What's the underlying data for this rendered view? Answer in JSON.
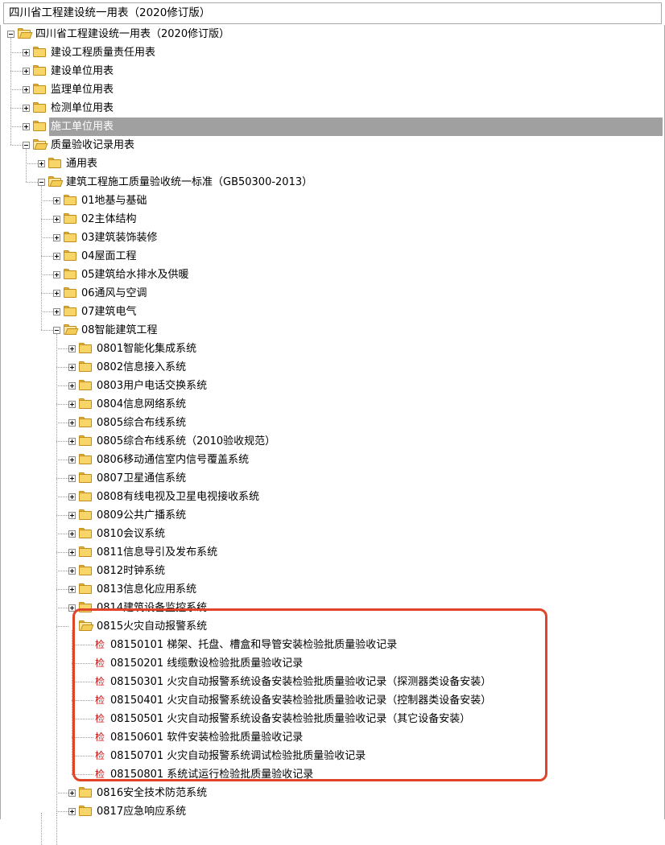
{
  "window": {
    "title": "四川省工程建设统一用表（2020修订版）"
  },
  "tree": {
    "root": "四川省工程建设统一用表（2020修订版）",
    "level1": [
      "建设工程质量责任用表",
      "建设单位用表",
      "监理单位用表",
      "检测单位用表",
      "施工单位用表"
    ],
    "quality_records": "质量验收记录用表",
    "level2": {
      "general": "通用表",
      "standard": "建筑工程施工质量验收统一标准（GB50300-2013）"
    },
    "level3": [
      "01地基与基础",
      "02主体结构",
      "03建筑装饰装修",
      "04屋面工程",
      "05建筑给水排水及供暖",
      "06通风与空调",
      "07建筑电气"
    ],
    "intelligent": "08智能建筑工程",
    "level4": [
      "0801智能化集成系统",
      "0802信息接入系统",
      "0803用户电话交换系统",
      "0804信息网络系统",
      "0805综合布线系统",
      "0805综合布线系统（2010验收规范）",
      "0806移动通信室内信号覆盖系统",
      "0807卫星通信系统",
      "0808有线电视及卫星电视接收系统",
      "0809公共广播系统",
      "0810会议系统",
      "0811信息导引及发布系统",
      "0812时钟系统",
      "0813信息化应用系统",
      "0814建筑设备监控系统"
    ],
    "fire_alarm": "0815火灾自动报警系统",
    "inspection_tag": "检",
    "fire_alarm_records": [
      "08150101 梯架、托盘、槽盒和导管安装检验批质量验收记录",
      "08150201 线缆敷设检验批质量验收记录",
      "08150301 火灾自动报警系统设备安装检验批质量验收记录（探测器类设备安装）",
      "08150401 火灾自动报警系统设备安装检验批质量验收记录（控制器类设备安装）",
      "08150501 火灾自动报警系统设备安装检验批质量验收记录（其它设备安装）",
      "08150601 软件安装检验批质量验收记录",
      "08150701 火灾自动报警系统调试检验批质量验收记录",
      "08150801 系统试运行检验批质量验收记录"
    ],
    "after": [
      "0816安全技术防范系统",
      "0817应急响应系统"
    ]
  },
  "colors": {
    "selected_bg": "#a0a0a0",
    "highlight_border": "#e0452a",
    "inspection_tag": "#cc1010"
  }
}
